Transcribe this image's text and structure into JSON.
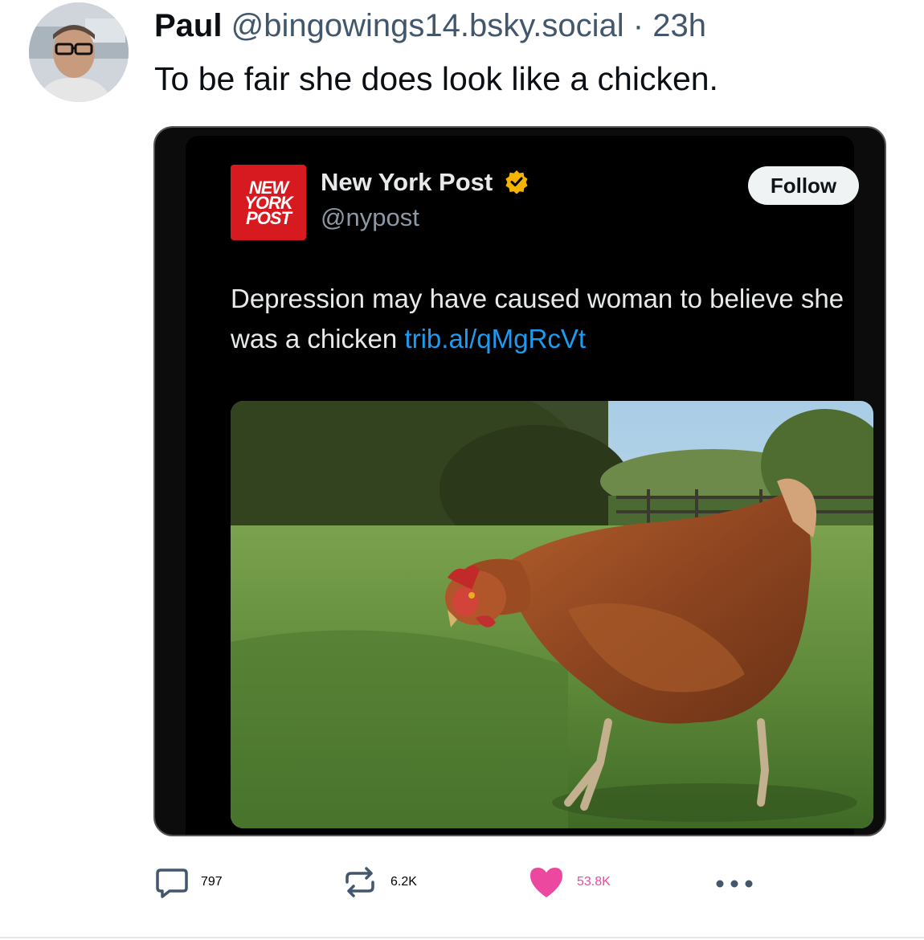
{
  "post": {
    "author_name": "Paul",
    "author_handle": "@bingowings14.bsky.social",
    "separator": "·",
    "time_ago": "23h",
    "text": "To be fair she does look like a chicken."
  },
  "embed": {
    "logo_lines": [
      "NEW",
      "YORK",
      "POST"
    ],
    "account_name": "New York Post",
    "account_handle": "@nypost",
    "verified_color": "#f4b400",
    "follow_label": "Follow",
    "text": "Depression may have caused woman to believe she was a chicken",
    "link": "trib.al/qMgRcVt",
    "image_icon": "chicken-photo"
  },
  "actions": {
    "replies": "797",
    "reposts": "6.2K",
    "likes": "53.8K",
    "like_color": "#ec48a0"
  }
}
